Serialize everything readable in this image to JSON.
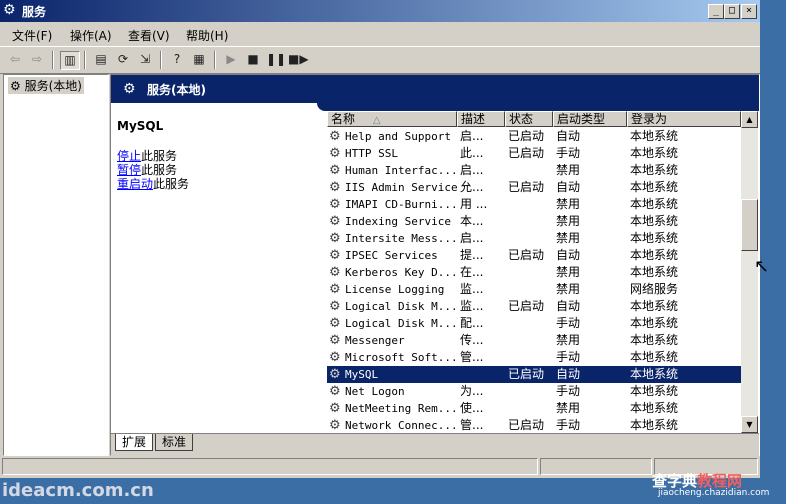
{
  "window": {
    "title": "服务",
    "minimize_glyph": "_",
    "maximize_glyph": "□",
    "close_glyph": "×"
  },
  "menu": {
    "file": "文件(F)",
    "action": "操作(A)",
    "view": "查看(V)",
    "help": "帮助(H)"
  },
  "toolbar": {
    "icons": [
      "back-arrow-icon",
      "forward-arrow-icon",
      "show-hide-tree-icon",
      "properties-icon",
      "refresh-icon",
      "export-list-icon",
      "help-icon",
      "show-hide-action-pane-icon",
      "start-icon",
      "stop-icon",
      "pause-icon",
      "restart-icon"
    ]
  },
  "tree": {
    "root_label": "服务(本地)"
  },
  "banner": {
    "title": "服务(本地)"
  },
  "description": {
    "service_name": "MySQL",
    "stop_link": "停止",
    "stop_suffix": "此服务",
    "pause_link": "暂停",
    "pause_suffix": "此服务",
    "restart_link": "重启动",
    "restart_suffix": "此服务"
  },
  "columns": {
    "name": "名称",
    "sort_indicator": "△",
    "description": "描述",
    "status": "状态",
    "startup_type": "启动类型",
    "logon_as": "登录为"
  },
  "services": [
    {
      "name": "Help and Support",
      "desc": "启...",
      "status": "已启动",
      "startup": "自动",
      "logon": "本地系统"
    },
    {
      "name": "HTTP SSL",
      "desc": "此...",
      "status": "已启动",
      "startup": "手动",
      "logon": "本地系统"
    },
    {
      "name": "Human Interfac...",
      "desc": "启...",
      "status": "",
      "startup": "禁用",
      "logon": "本地系统"
    },
    {
      "name": "IIS Admin Service",
      "desc": "允...",
      "status": "已启动",
      "startup": "自动",
      "logon": "本地系统"
    },
    {
      "name": "IMAPI CD-Burni...",
      "desc": "用 ...",
      "status": "",
      "startup": "禁用",
      "logon": "本地系统"
    },
    {
      "name": "Indexing Service",
      "desc": "本...",
      "status": "",
      "startup": "禁用",
      "logon": "本地系统"
    },
    {
      "name": "Intersite Mess...",
      "desc": "启...",
      "status": "",
      "startup": "禁用",
      "logon": "本地系统"
    },
    {
      "name": "IPSEC Services",
      "desc": "提...",
      "status": "已启动",
      "startup": "自动",
      "logon": "本地系统"
    },
    {
      "name": "Kerberos Key D...",
      "desc": "在...",
      "status": "",
      "startup": "禁用",
      "logon": "本地系统"
    },
    {
      "name": "License Logging",
      "desc": "监...",
      "status": "",
      "startup": "禁用",
      "logon": "网络服务"
    },
    {
      "name": "Logical Disk M...",
      "desc": "监...",
      "status": "已启动",
      "startup": "自动",
      "logon": "本地系统"
    },
    {
      "name": "Logical Disk M...",
      "desc": "配...",
      "status": "",
      "startup": "手动",
      "logon": "本地系统"
    },
    {
      "name": "Messenger",
      "desc": "传...",
      "status": "",
      "startup": "禁用",
      "logon": "本地系统"
    },
    {
      "name": "Microsoft Soft...",
      "desc": "管...",
      "status": "",
      "startup": "手动",
      "logon": "本地系统"
    },
    {
      "name": "MySQL",
      "desc": "",
      "status": "已启动",
      "startup": "自动",
      "logon": "本地系统",
      "selected": true
    },
    {
      "name": "Net Logon",
      "desc": "为...",
      "status": "",
      "startup": "手动",
      "logon": "本地系统"
    },
    {
      "name": "NetMeeting Rem...",
      "desc": "使...",
      "status": "",
      "startup": "禁用",
      "logon": "本地系统"
    },
    {
      "name": "Network Connec...",
      "desc": "管...",
      "status": "已启动",
      "startup": "手动",
      "logon": "本地系统"
    }
  ],
  "tabs": {
    "extended": "扩展",
    "standard": "标准"
  },
  "watermarks": {
    "site1": "ideacm.com.cn",
    "site2_a": "查字典",
    "site2_b": "教程网",
    "site2_url": "jiaocheng.chazidian.com"
  },
  "colors": {
    "selection": "#0a246a",
    "link": "#0000ff",
    "desktop": "#3a6ea5"
  }
}
